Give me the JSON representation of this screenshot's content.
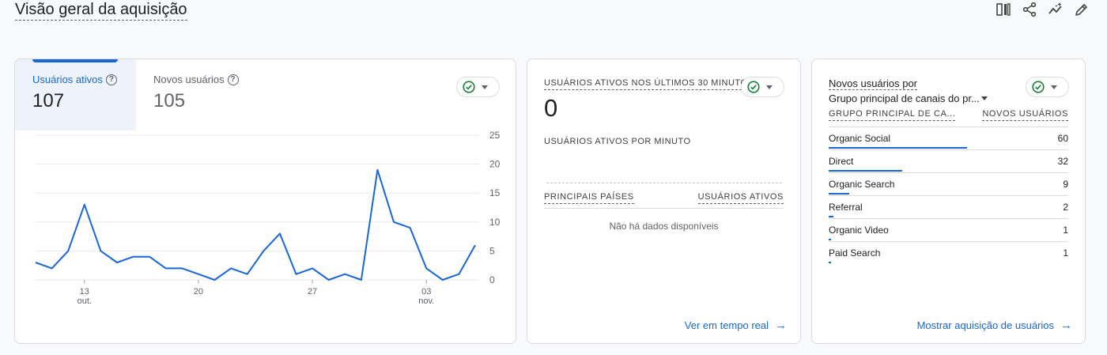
{
  "page": {
    "title": "Visão geral da aquisição"
  },
  "toolbar": {
    "icons": [
      "compare-icon",
      "share-icon",
      "insights-icon",
      "edit-icon"
    ]
  },
  "colors": {
    "accent": "#1967d2",
    "check": "#188038",
    "grid": "#e8eaed"
  },
  "overview": {
    "tabs": [
      {
        "label": "Usuários ativos",
        "value": "107"
      },
      {
        "label": "Novos usuários",
        "value": "105"
      }
    ]
  },
  "chart_data": {
    "type": "line",
    "x": [
      "10 out",
      "11 out",
      "12 out",
      "13 out",
      "14 out",
      "15 out",
      "16 out",
      "17 out",
      "18 out",
      "19 out",
      "20 out",
      "21 out",
      "22 out",
      "23 out",
      "24 out",
      "25 out",
      "26 out",
      "27 out",
      "28 out",
      "29 out",
      "30 out",
      "31 out",
      "01 nov",
      "02 nov",
      "03 nov",
      "04 nov",
      "05 nov"
    ],
    "series": [
      {
        "values": [
          3,
          2,
          5,
          13,
          5,
          3,
          4,
          4,
          2,
          2,
          1,
          0,
          2,
          1,
          5,
          8,
          1,
          2,
          0,
          1,
          0,
          19,
          10,
          9,
          2,
          0,
          1,
          6
        ]
      }
    ],
    "x_ticks": [
      {
        "day": "13",
        "month": "out.",
        "index": 3
      },
      {
        "day": "20",
        "month": "",
        "index": 10
      },
      {
        "day": "27",
        "month": "",
        "index": 17
      },
      {
        "day": "03",
        "month": "nov.",
        "index": 24
      }
    ],
    "y_ticks": [
      "25",
      "20",
      "15",
      "10",
      "5",
      "0"
    ],
    "ylim": [
      0,
      25
    ],
    "grid": true,
    "color": "#1967d2"
  },
  "realtime": {
    "heading": "USUÁRIOS ATIVOS NOS ÚLTIMOS 30 MINUTOS",
    "value": "0",
    "subheading": "USUÁRIOS ATIVOS POR MINUTO",
    "col_countries": "PRINCIPAIS PAÍSES",
    "col_users": "USUÁRIOS ATIVOS",
    "no_data": "Não há dados disponíveis",
    "link": "Ver em tempo real"
  },
  "acquisition": {
    "title_line1": "Novos usuários por",
    "title_line2": "Grupo principal de canais do pr...",
    "col_group": "GRUPO PRINCIPAL DE CA...",
    "col_new_users": "NOVOS USUÁRIOS",
    "rows": [
      {
        "name": "Organic Social",
        "value": "60",
        "share": 60
      },
      {
        "name": "Direct",
        "value": "32",
        "share": 32
      },
      {
        "name": "Organic Search",
        "value": "9",
        "share": 9
      },
      {
        "name": "Referral",
        "value": "2",
        "share": 2
      },
      {
        "name": "Organic Video",
        "value": "1",
        "share": 1
      },
      {
        "name": "Paid Search",
        "value": "1",
        "share": 1
      }
    ],
    "max_share": 60,
    "link": "Mostrar aquisição de usuários"
  }
}
